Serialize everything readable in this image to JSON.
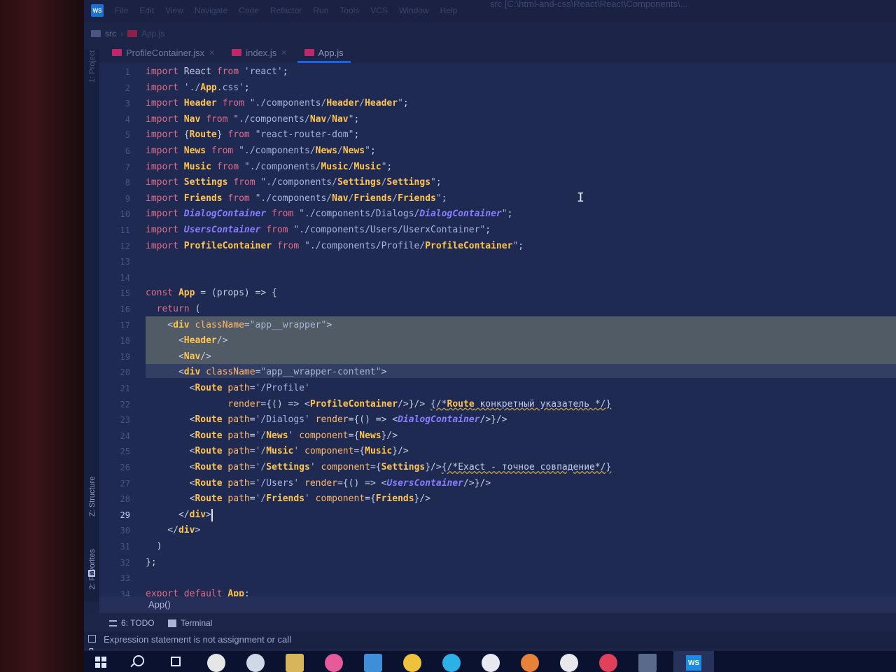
{
  "window": {
    "menu_items": [
      "File",
      "Edit",
      "View",
      "Navigate",
      "Code",
      "Refactor",
      "Run",
      "Tools",
      "VCS",
      "Window",
      "Help"
    ],
    "title_path": "src [C:\\html-and-css\\React\\React\\Components\\..."
  },
  "breadcrumb": {
    "folder": "src",
    "file": "App.js"
  },
  "tabs": [
    {
      "label": "ProfileContainer.jsx",
      "active": false
    },
    {
      "label": "index.js",
      "active": false
    },
    {
      "label": "App.js",
      "active": true
    }
  ],
  "side_panels": {
    "project": "1: Project",
    "structure": "Z: Structure",
    "favorites": "2: Favorites"
  },
  "editor": {
    "current_line": 29,
    "lines": [
      {
        "n": "1",
        "text": "import React from 'react';"
      },
      {
        "n": "2",
        "text": "import './App.css';"
      },
      {
        "n": "3",
        "text": "import Header from \"./components/Header/Header\";"
      },
      {
        "n": "4",
        "text": "import Nav from \"./components/Nav/Nav\";"
      },
      {
        "n": "5",
        "text": "import {Route} from \"react-router-dom\";"
      },
      {
        "n": "6",
        "text": "import News from \"./components/News/News\";"
      },
      {
        "n": "7",
        "text": "import Music from \"./components/Music/Music\";"
      },
      {
        "n": "8",
        "text": "import Settings from \"./components/Settings/Settings\";"
      },
      {
        "n": "9",
        "text": "import Friends from \"./components/Nav/Friends/Friends\";"
      },
      {
        "n": "10",
        "text": "import DialogContainer from \"./components/Dialogs/DialogContainer\";"
      },
      {
        "n": "11",
        "text": "import UsersContainer from \"./components/Users/UserxContainer\";"
      },
      {
        "n": "12",
        "text": "import ProfileContainer from \"./components/Profile/ProfileContainer\";"
      },
      {
        "n": "13",
        "text": ""
      },
      {
        "n": "14",
        "text": ""
      },
      {
        "n": "15",
        "text": "const App = (props) => {"
      },
      {
        "n": "16",
        "text": "  return ("
      },
      {
        "n": "17",
        "text": "    <div className=\"app__wrapper\">"
      },
      {
        "n": "18",
        "text": "      <Header/>"
      },
      {
        "n": "19",
        "text": "      <Nav/>"
      },
      {
        "n": "20",
        "text": "      <div className=\"app__wrapper-content\">"
      },
      {
        "n": "21",
        "text": "        <Route path='/Profile'"
      },
      {
        "n": "22",
        "text": "               render={() => <ProfileContainer/>}/> {/*Route конкретный указатель */}"
      },
      {
        "n": "23",
        "text": "        <Route path='/Dialogs' render={() => <DialogContainer/>}/>"
      },
      {
        "n": "24",
        "text": "        <Route path='/News' component={News}/>"
      },
      {
        "n": "25",
        "text": "        <Route path='/Music' component={Music}/>"
      },
      {
        "n": "26",
        "text": "        <Route path='/Settings' component={Settings}/>{/*Exact - точное совпадение*/}"
      },
      {
        "n": "27",
        "text": "        <Route path='/Users' render={() => <UsersContainer/>}/>"
      },
      {
        "n": "28",
        "text": "        <Route path='/Friends' component={Friends}/>"
      },
      {
        "n": "29",
        "text": "      </div>"
      },
      {
        "n": "30",
        "text": "    </div>"
      },
      {
        "n": "31",
        "text": "  )"
      },
      {
        "n": "32",
        "text": "};"
      },
      {
        "n": "33",
        "text": ""
      },
      {
        "n": "34",
        "text": "export default App;"
      }
    ]
  },
  "function_breadcrumb": "App()",
  "tool_windows": {
    "todo": "6: TODO",
    "terminal": "Terminal"
  },
  "status": {
    "message": "Expression statement is not assignment or call"
  },
  "colors": {
    "accent": "#1b63e6",
    "keyword": "#e06c8a",
    "identifier": "#ffc44d",
    "italic_identifier": "#8b7cff",
    "background": "#1f2a52"
  },
  "taskbar": {
    "icons": [
      "windows-start-icon",
      "search-icon",
      "task-view-icon",
      "yandex-browser-icon",
      "chrome-icon",
      "file-explorer-icon",
      "media-icon",
      "store-icon",
      "app-icon",
      "skype-icon",
      "word-icon",
      "firefox-icon",
      "download-icon",
      "opera-icon",
      "desktop-icon",
      "webstorm-icon"
    ]
  }
}
